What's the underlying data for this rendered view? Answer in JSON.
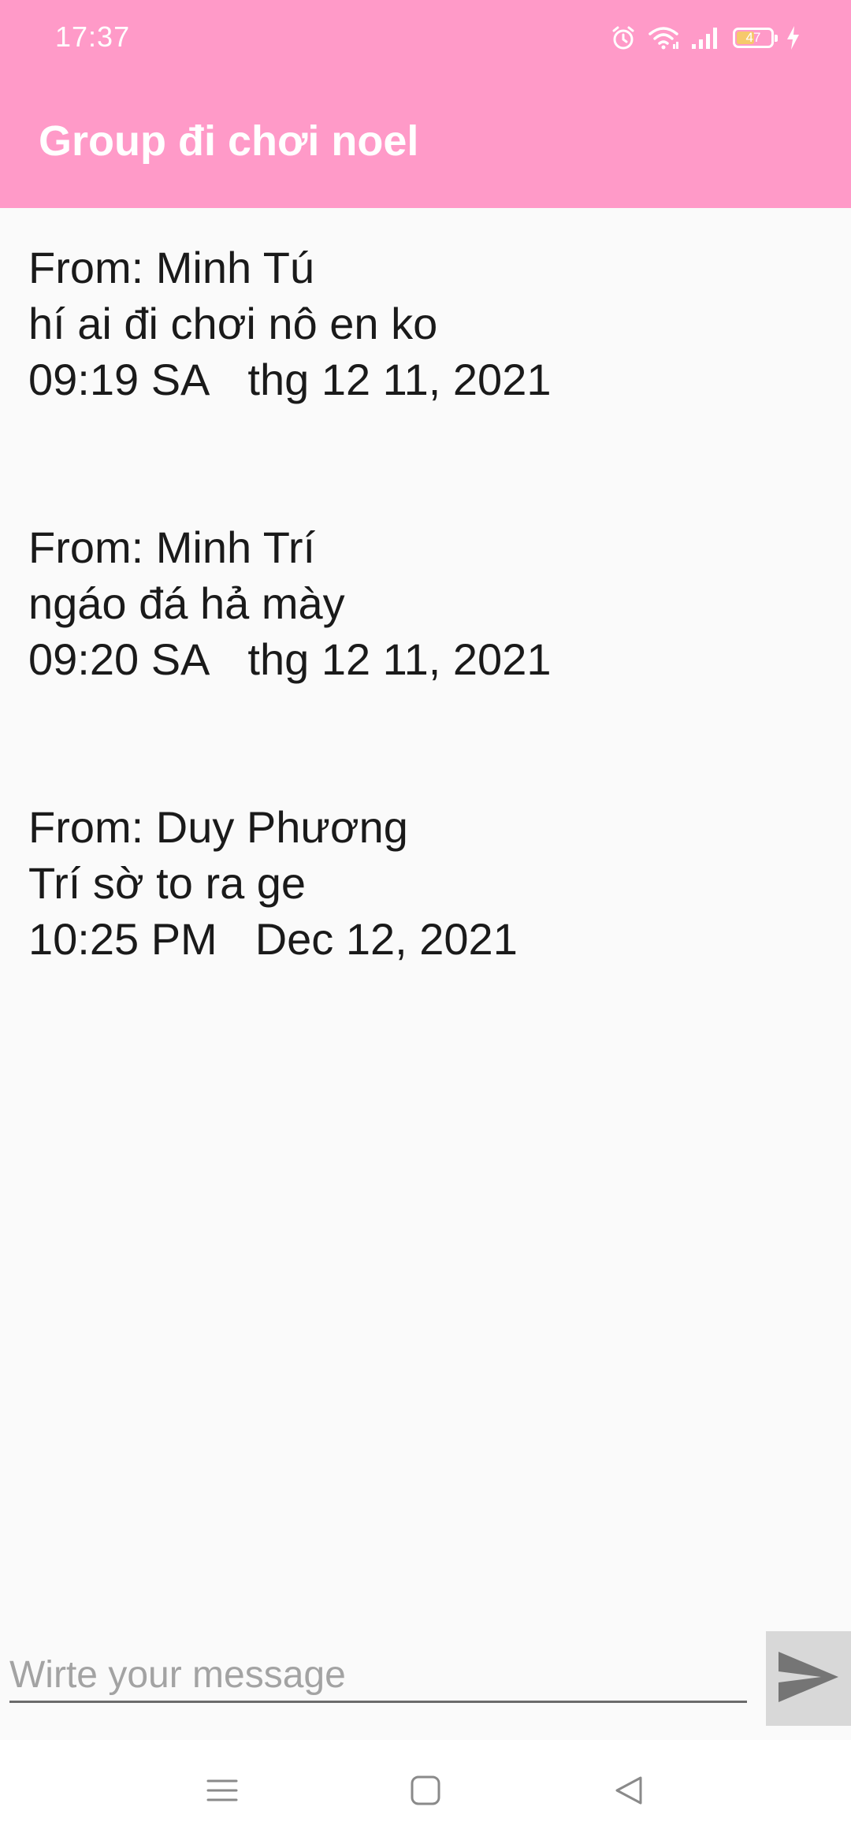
{
  "status_bar": {
    "time": "17:37",
    "battery_level": "47",
    "icons": [
      "alarm-icon",
      "wifi-icon",
      "signal-icon",
      "battery-icon",
      "charging-icon"
    ]
  },
  "header": {
    "title": "Group đi chơi noel"
  },
  "messages": [
    {
      "from": "From: Minh Tú",
      "text": "hí ai đi chơi nô en ko",
      "time": "09:19 SA",
      "date": "thg 12 11, 2021"
    },
    {
      "from": "From: Minh Trí",
      "text": "ngáo đá hả mày",
      "time": "09:20 SA",
      "date": "thg 12 11, 2021"
    },
    {
      "from": "From: Duy Phương",
      "text": "Trí sờ to ra ge",
      "time": "10:25 PM",
      "date": "Dec 12, 2021"
    }
  ],
  "composer": {
    "placeholder": "Wirte your message",
    "value": "",
    "send_icon": "send-icon"
  },
  "nav_bar": {
    "icons": [
      "menu-icon",
      "home-icon",
      "back-icon"
    ]
  },
  "colors": {
    "accent": "#ff9ac8",
    "background": "#fafafa",
    "send_button": "#d8d8d8"
  }
}
